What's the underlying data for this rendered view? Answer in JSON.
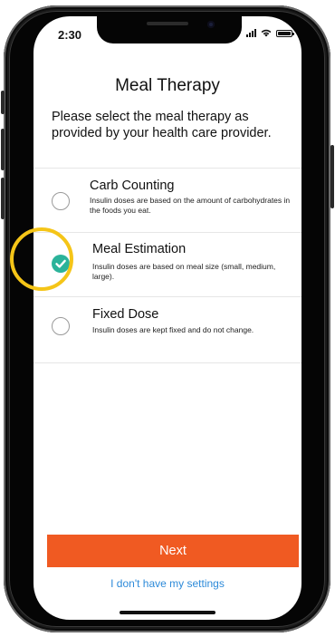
{
  "status_bar": {
    "time": "2:30"
  },
  "header": {
    "title": "Meal Therapy"
  },
  "instructions": "Please select the meal therapy as provided by your health care provider.",
  "options": [
    {
      "title": "Carb Counting",
      "description": "Insulin doses are based on the amount of carbohydrates in the foods you eat.",
      "selected": false
    },
    {
      "title": "Meal Estimation",
      "description": "Insulin doses are based on meal size (small, medium, large).",
      "selected": true
    },
    {
      "title": "Fixed Dose",
      "description": "Insulin doses are kept fixed and do not change.",
      "selected": false
    }
  ],
  "footer": {
    "next_label": "Next",
    "no_settings_link": "I don't have my settings"
  },
  "colors": {
    "accent": "#f05a22",
    "selected": "#2bb39a",
    "highlight": "#f5c518",
    "link": "#2d8ad9"
  },
  "icons": {
    "status": [
      "signal-icon",
      "wifi-icon",
      "battery-icon"
    ],
    "checkmark": "checkmark-icon"
  }
}
